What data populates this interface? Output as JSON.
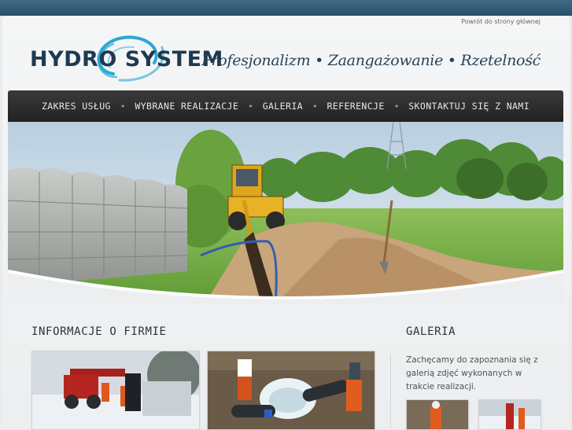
{
  "header": {
    "back_link": "Powrót do strony głównej",
    "logo_text": "HYDRO SYSTEM",
    "slogan": "Profesjonalizm • Zaangażowanie • Rzetelność"
  },
  "nav": {
    "items": [
      {
        "label": "ZAKRES USŁUG"
      },
      {
        "label": "WYBRANE REALIZACJE"
      },
      {
        "label": "GALERIA"
      },
      {
        "label": "REFERENCJE"
      },
      {
        "label": "SKONTAKTUJ SIĘ Z NAMI"
      }
    ],
    "separator": "•"
  },
  "main": {
    "info_title": "INFORMACJE O FIRMIE"
  },
  "sidebar": {
    "gallery_title": "GALERIA",
    "gallery_text": "Zachęcamy do zapoznania się z galerią zdjęć wykonanych w trakcie realizacji."
  },
  "colors": {
    "topbar": "#2f566f",
    "brand": "#1f3a4f",
    "nav_bg": "#2b2b2b",
    "logo_swirl": "#2aa7d6"
  }
}
